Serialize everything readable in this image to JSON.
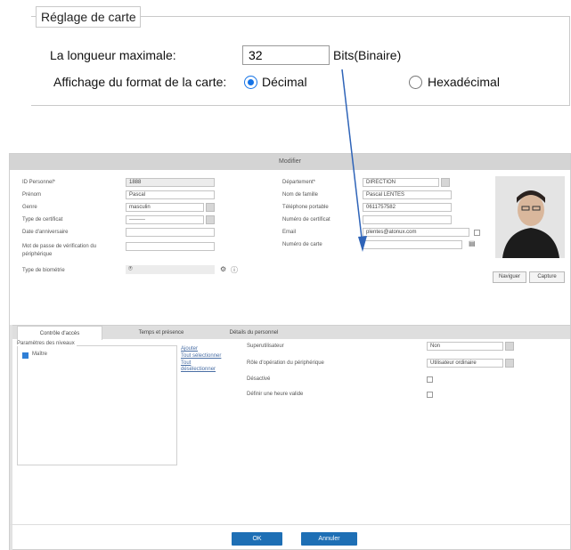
{
  "card_settings": {
    "legend": "Réglage de carte",
    "max_length_label": "La longueur maximale:",
    "max_length_value": "32",
    "max_length_unit": "Bits(Binaire)",
    "format_label": "Affichage du format de la carte:",
    "options": [
      {
        "label": "Décimal",
        "selected": true
      },
      {
        "label": "Hexadécimal",
        "selected": false
      }
    ]
  },
  "modal": {
    "title": "Modifier",
    "left_fields": [
      {
        "label": "ID Personnel*",
        "value": "1888"
      },
      {
        "label": "Prénom",
        "value": "Pascal"
      },
      {
        "label": "Genre",
        "value": "masculin"
      },
      {
        "label": "Type de certificat",
        "value": "---------"
      },
      {
        "label": "Date d'anniversaire",
        "value": ""
      },
      {
        "label": "Mot de passe de vérification du périphérique",
        "value": ""
      },
      {
        "label": "Type de biométrie",
        "value": ""
      }
    ],
    "right_fields": [
      {
        "label": "Département*",
        "value": "DIRECTION"
      },
      {
        "label": "Nom de famille",
        "value": "Pascal LENTES"
      },
      {
        "label": "Téléphone portable",
        "value": "0611757582"
      },
      {
        "label": "Numéro de certificat",
        "value": ""
      },
      {
        "label": "Email",
        "value": "plentes@atonux.com"
      },
      {
        "label": "Numéro de carte",
        "value": ""
      }
    ],
    "photo_buttons": [
      "Naviguer",
      "Capture"
    ],
    "tabs": [
      "Contrôle d'accès",
      "Temps et présence",
      "Détails du personnel"
    ],
    "access": {
      "permission_legend": "Paramètres des niveaux",
      "levels": [
        {
          "label": "Maître",
          "checked": true
        }
      ],
      "links": [
        "Ajouter",
        "Tout sélectionner",
        "Tout désélectionner"
      ],
      "settings": [
        {
          "label": "Superutilisateur",
          "value": "Non"
        },
        {
          "label": "Rôle d'opération du périphérique",
          "value": "Utilisateur ordinaire"
        },
        {
          "label": "Désactivé",
          "value": ""
        },
        {
          "label": "Définir une heure valide",
          "value": ""
        }
      ]
    },
    "buttons": {
      "ok": "OK",
      "cancel": "Annuler"
    }
  },
  "colors": {
    "accent": "#1473e6",
    "button_blue": "#1e6fb5",
    "arrow": "#2f64b8"
  }
}
